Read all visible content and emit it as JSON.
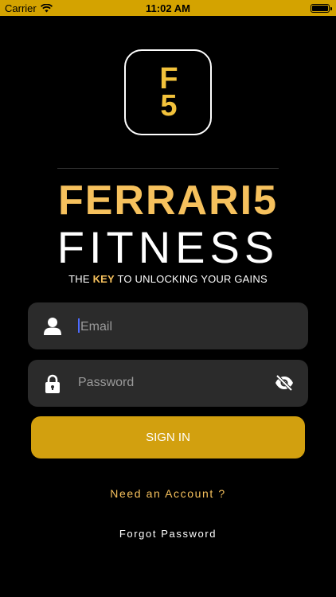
{
  "status_bar": {
    "carrier": "Carrier",
    "time": "11:02 AM",
    "background": "#d4a300"
  },
  "logo": {
    "top_char": "F",
    "bottom_char": "5",
    "color": "#f2c23b"
  },
  "brand": {
    "line1": "FERRARI5",
    "line2": "FITNESS"
  },
  "tagline": {
    "before": "THE ",
    "key": "KEY",
    "after": " TO UNLOCKING YOUR GAINS"
  },
  "email_field": {
    "placeholder": "Email",
    "icon": "person-icon"
  },
  "password_field": {
    "placeholder": "Password",
    "icon": "lock-icon",
    "toggle_icon": "eye-slash-icon"
  },
  "signin_button": {
    "label": "SIGN IN",
    "color": "#d2a00f"
  },
  "links": {
    "need_account": "Need an Account ?",
    "forgot_password": "Forgot Password"
  },
  "colors": {
    "accent": "#f6c15d",
    "field_background": "#2b2b2b",
    "page_background": "#000000"
  }
}
